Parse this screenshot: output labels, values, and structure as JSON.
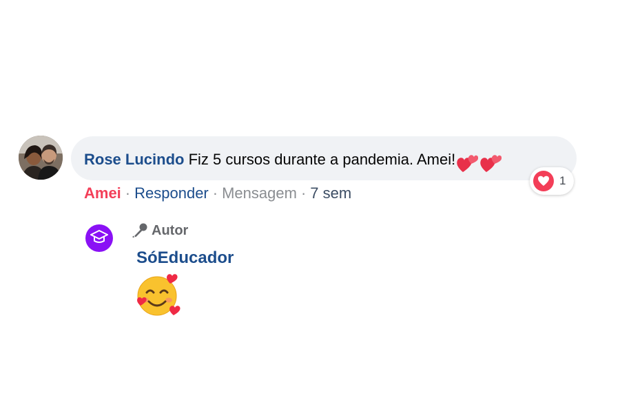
{
  "comment": {
    "author": "Rose Lucindo",
    "text": "Fiz 5 cursos durante a pandemia. Amei!",
    "trailing_emojis": [
      "two-hearts-icon",
      "two-hearts-icon"
    ],
    "reaction": {
      "icon": "love-reaction-icon",
      "count": "1",
      "color": "#f33e58"
    },
    "actions": {
      "love": "Amei",
      "reply": "Responder",
      "message": "Mensagem",
      "time": "7 sem",
      "separator": "·"
    }
  },
  "reply": {
    "badge_icon": "microphone-icon",
    "badge_label": "Autor",
    "author": "SóEducador",
    "avatar_icon": "graduation-cap-icon",
    "avatar_color": "#8a11f5",
    "content_emoji": "smiling-face-with-hearts-icon"
  },
  "colors": {
    "bubble": "#f0f2f5",
    "name": "#1c4d8c",
    "love": "#f33e58"
  }
}
